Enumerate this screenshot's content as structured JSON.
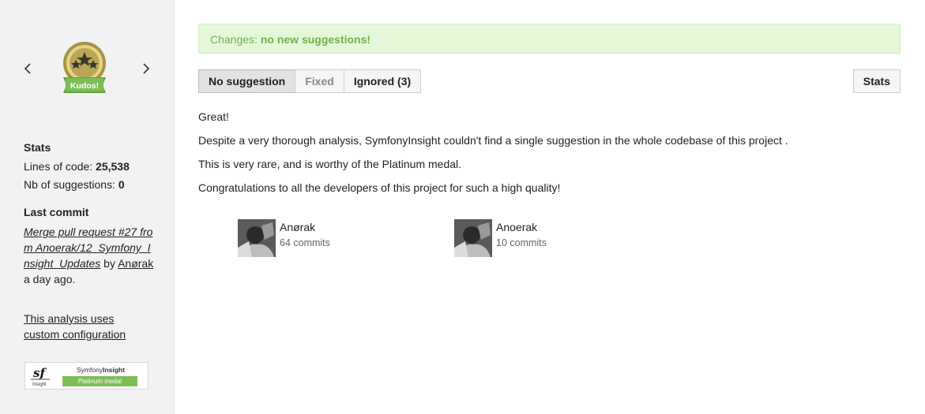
{
  "sidebar": {
    "stats_title": "Stats",
    "lines_of_code_label": "Lines of code: ",
    "lines_of_code_value": "25,538",
    "suggestions_label": "Nb of suggestions: ",
    "suggestions_value": "0",
    "last_commit_title": "Last commit",
    "commit_message": "Merge pull request #27 from Anoerak/12_Symfony_Insight_Updates",
    "commit_by": " by ",
    "commit_author": "Anørak",
    "commit_time": "a day ago.",
    "config_link": "This analysis uses custom configuration",
    "medal_label": "Kudos!",
    "badge_brand_prefix": "Symfony",
    "badge_brand_suffix": "Insight",
    "badge_logo_text": "sf",
    "badge_logo_sub": "Insight",
    "badge_medal": "Platinum medal"
  },
  "main": {
    "changes_label": "Changes: ",
    "changes_value": "no new suggestions!",
    "tabs": [
      {
        "label": "No suggestion"
      },
      {
        "label": "Fixed"
      },
      {
        "label": "Ignored (3)"
      }
    ],
    "stats_button": "Stats",
    "paragraphs": [
      "Great!",
      "Despite a very thorough analysis, SymfonyInsight couldn't find a single suggestion in the whole codebase of this project .",
      "This is very rare, and is worthy of the Platinum medal.",
      "Congratulations to all the developers of this project for such a high quality!"
    ],
    "contributors": [
      {
        "name": "Anørak",
        "commits": "64 commits"
      },
      {
        "name": "Anoerak",
        "commits": "10 commits"
      }
    ]
  },
  "colors": {
    "changes_bg": "#e4f8d9",
    "changes_text": "#71b14a",
    "medal_gold": "#c9b04a",
    "medal_ribbon": "#7cbd56"
  }
}
